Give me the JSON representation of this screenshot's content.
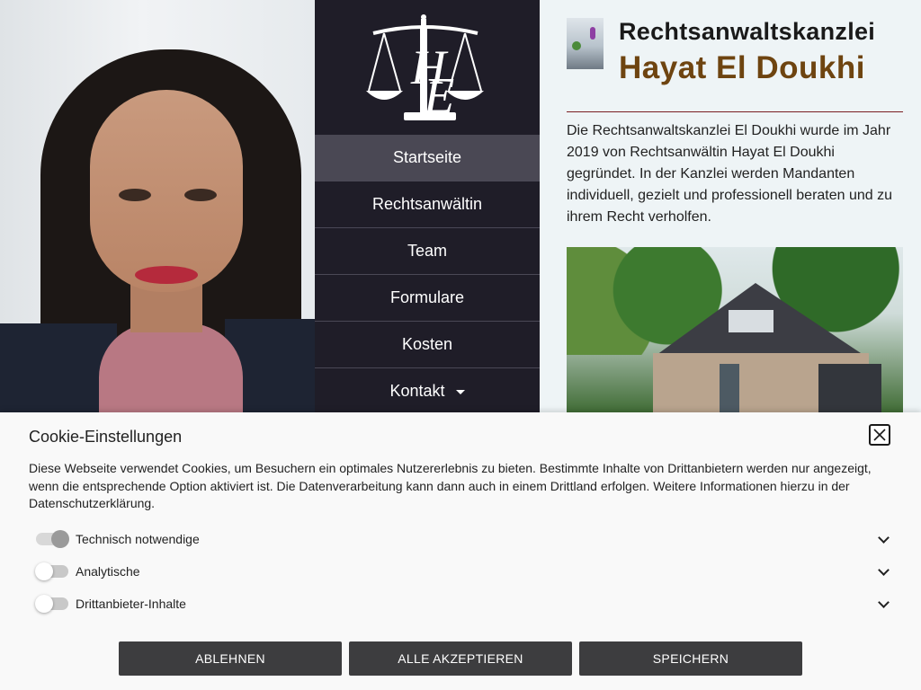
{
  "brand": {
    "line1": "Rechtsanwaltskanzlei",
    "line2": "Hayat El Doukhi"
  },
  "logo": {
    "icon": "scales-of-justice-monogram-icon",
    "monogram": "HE"
  },
  "nav": {
    "items": [
      {
        "label": "Startseite",
        "active": true
      },
      {
        "label": "Rechtsanwältin"
      },
      {
        "label": "Team"
      },
      {
        "label": "Formulare"
      },
      {
        "label": "Kosten"
      },
      {
        "label": "Kontakt",
        "has_dropdown": true
      }
    ]
  },
  "content": {
    "intro": "Die Rechtsanwaltskanzlei El Doukhi  wurde  im Jahr 2019 von Rechtsanwältin Hayat El Doukhi gegründet. In der Kanzlei werden Mandanten individuell, gezielt und professionell beraten und zu ihrem Recht verholfen."
  },
  "cookie": {
    "title": "Cookie-Einstellungen",
    "text": "Diese Webseite verwendet Cookies, um Besuchern ein optimales Nutzererlebnis zu bieten. Bestimmte Inhalte von Drittanbietern werden nur angezeigt, wenn die entsprechende Option aktiviert ist. Die Datenverarbeitung kann dann auch in einem Drittland erfolgen. Weitere Informationen hierzu in der Datenschutzerklärung.",
    "options": [
      {
        "label": "Technisch notwendige",
        "enabled": true
      },
      {
        "label": "Analytische",
        "enabled": false
      },
      {
        "label": "Drittanbieter-Inhalte",
        "enabled": false
      }
    ],
    "buttons": {
      "decline": "ABLEHNEN",
      "accept_all": "ALLE AKZEPTIEREN",
      "save": "SPEICHERN"
    }
  },
  "colors": {
    "nav_bg": "#1f1d28",
    "nav_active": "#4a4854",
    "brand_accent": "#6e4410",
    "rule": "#7a1e22",
    "button_bg": "#3d3d3f"
  }
}
